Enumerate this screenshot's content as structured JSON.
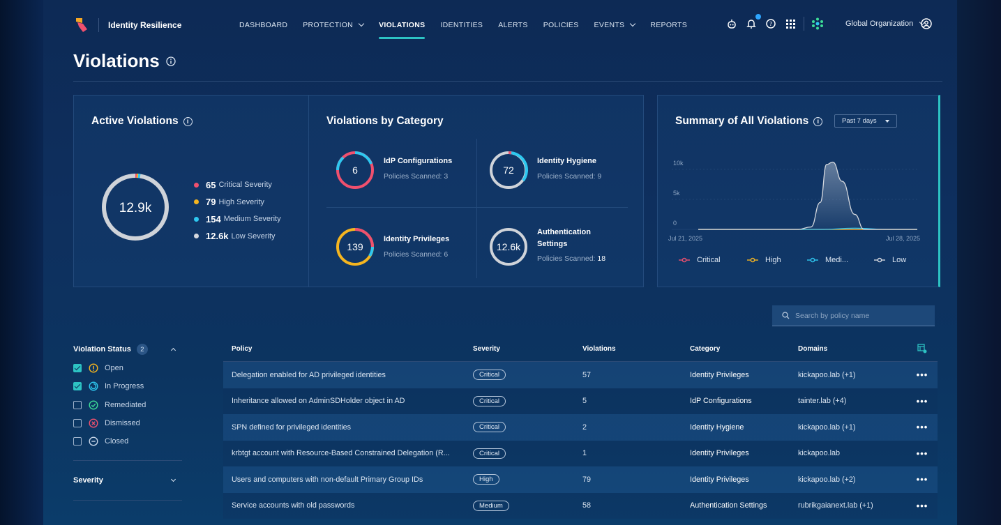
{
  "brand": {
    "name": "Identity Resilience",
    "accent": "#2dc3c3"
  },
  "nav": [
    {
      "label": "DASHBOARD",
      "has_menu": false,
      "active": false
    },
    {
      "label": "PROTECTION",
      "has_menu": true,
      "active": false
    },
    {
      "label": "VIOLATIONS",
      "has_menu": false,
      "active": true
    },
    {
      "label": "IDENTITIES",
      "has_menu": false,
      "active": false
    },
    {
      "label": "ALERTS",
      "has_menu": false,
      "active": false
    },
    {
      "label": "POLICIES",
      "has_menu": false,
      "active": false
    },
    {
      "label": "EVENTS",
      "has_menu": true,
      "active": false
    },
    {
      "label": "REPORTS",
      "has_menu": false,
      "active": false
    }
  ],
  "header_icons": [
    "bot-icon",
    "bell-icon",
    "help-icon",
    "apps-grid-icon",
    "org-logo-icon"
  ],
  "org": {
    "label": "Global Organization"
  },
  "page": {
    "title": "Violations"
  },
  "active_violations": {
    "title": "Active Violations",
    "total": "12.9k",
    "legend": [
      {
        "value": "65",
        "label": "Critical Severity",
        "color": "#f0506e"
      },
      {
        "value": "79",
        "label": "High Severity",
        "color": "#f5b51f"
      },
      {
        "value": "154",
        "label": "Medium Severity",
        "color": "#2ec8f0"
      },
      {
        "value": "12.6k",
        "label": "Low Severity",
        "color": "#d4d8de"
      }
    ]
  },
  "by_category": {
    "title": "Violations by Category",
    "items": [
      {
        "value": "6",
        "name": "IdP Configurations",
        "scanned_label": "Policies Scanned:",
        "scanned": "3"
      },
      {
        "value": "72",
        "name": "Identity Hygiene",
        "scanned_label": "Policies Scanned:",
        "scanned": "9"
      },
      {
        "value": "139",
        "name": "Identity Privileges",
        "scanned_label": "Policies Scanned:",
        "scanned": "6"
      },
      {
        "value": "12.6k",
        "name": "Authentication",
        "name2": "Settings",
        "scanned_label": "Policies Scanned:",
        "scanned": "18"
      }
    ]
  },
  "summary": {
    "title": "Summary of All Violations",
    "range": "Past 7 days",
    "legend": [
      {
        "label": "Critical",
        "color": "#f0506e"
      },
      {
        "label": "High",
        "color": "#f5b51f"
      },
      {
        "label": "Medi...",
        "color": "#2ec8f0"
      },
      {
        "label": "Low",
        "color": "#d4d8de"
      }
    ]
  },
  "chart_data": {
    "type": "area",
    "x_start": "Jul 21, 2025",
    "x_end": "Jul 28, 2025",
    "y_ticks": [
      "10k",
      "5k",
      "0"
    ],
    "ylim": [
      0,
      13000
    ],
    "grid": true,
    "legend_position": "bottom",
    "series": [
      {
        "name": "Critical",
        "x": [
          0,
          1,
          2,
          3,
          4,
          5,
          6,
          7
        ],
        "values": [
          0,
          0,
          0,
          0,
          0,
          0,
          0,
          0
        ]
      },
      {
        "name": "High",
        "x": [
          0,
          1,
          2,
          3,
          4,
          5,
          6,
          7
        ],
        "values": [
          0,
          0,
          0,
          0,
          0,
          0,
          0,
          0
        ]
      },
      {
        "name": "Medi...",
        "x": [
          0,
          1,
          2,
          3,
          4,
          5,
          6,
          7
        ],
        "values": [
          0,
          0,
          0,
          0,
          0,
          200,
          0,
          0
        ]
      },
      {
        "name": "Low",
        "x": [
          0,
          2.5,
          3.2,
          3.6,
          3.9,
          4.1,
          4.3,
          4.6,
          5.0,
          5.3,
          7
        ],
        "values": [
          0,
          0,
          0,
          400,
          4500,
          10800,
          11200,
          8000,
          2500,
          0,
          0
        ]
      }
    ]
  },
  "search": {
    "placeholder": "Search by policy name"
  },
  "filters": {
    "status_title": "Violation Status",
    "status_count": "2",
    "options": [
      {
        "label": "Open",
        "checked": true,
        "icon": "warning-circle-icon",
        "color": "#f5b51f"
      },
      {
        "label": "In Progress",
        "checked": true,
        "icon": "progress-circle-icon",
        "color": "#2ec8f0"
      },
      {
        "label": "Remediated",
        "checked": false,
        "icon": "check-circle-icon",
        "color": "#3ddc97"
      },
      {
        "label": "Dismissed",
        "checked": false,
        "icon": "x-circle-icon",
        "color": "#f0506e"
      },
      {
        "label": "Closed",
        "checked": false,
        "icon": "minus-circle-icon",
        "color": "#c8d6e8"
      }
    ],
    "severity_title": "Severity"
  },
  "table": {
    "columns": [
      "Policy",
      "Severity",
      "Violations",
      "Category",
      "Domains"
    ],
    "rows": [
      {
        "policy": "Delegation enabled for AD privileged identities",
        "severity": "Critical",
        "violations": "57",
        "category": "Identity Privileges",
        "domains": "kickapoo.lab (+1)"
      },
      {
        "policy": "Inheritance allowed on AdminSDHolder object in AD",
        "severity": "Critical",
        "violations": "5",
        "category": "IdP Configurations",
        "domains": "tainter.lab (+4)"
      },
      {
        "policy": "SPN defined for privileged identities",
        "severity": "Critical",
        "violations": "2",
        "category": "Identity Hygiene",
        "domains": "kickapoo.lab (+1)"
      },
      {
        "policy": "krbtgt account with Resource-Based Constrained Delegation (R...",
        "severity": "Critical",
        "violations": "1",
        "category": "Identity Privileges",
        "domains": "kickapoo.lab"
      },
      {
        "policy": "Users and computers with non-default Primary Group IDs",
        "severity": "High",
        "violations": "79",
        "category": "Identity Privileges",
        "domains": "kickapoo.lab (+2)"
      },
      {
        "policy": "Service accounts with old passwords",
        "severity": "Medium",
        "violations": "58",
        "category": "Authentication Settings",
        "domains": "rubrikgaianext.lab (+1)"
      }
    ]
  }
}
